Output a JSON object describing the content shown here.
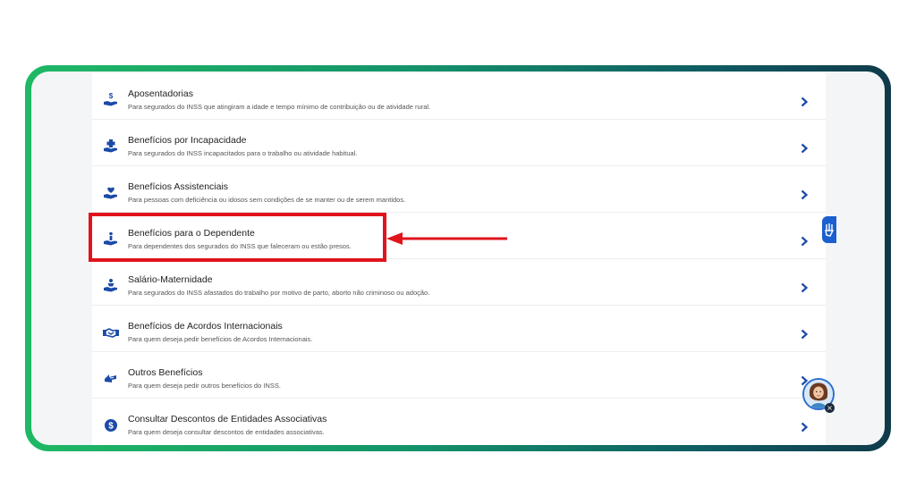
{
  "services": [
    {
      "title": "Aposentadorias",
      "description": "Para segurados do INSS que atingiram a idade e tempo mínimo de contribuição ou de atividade rural.",
      "icon": "hand-dollar-icon"
    },
    {
      "title": "Benefícios por Incapacidade",
      "description": "Para segurados do INSS incapacitados para o trabalho ou atividade habitual.",
      "icon": "hand-medical-cross-icon"
    },
    {
      "title": "Benefícios Assistenciais",
      "description": "Para pessoas com deficiência ou idosos sem condições de se manter ou de serem mantidos.",
      "icon": "hand-heart-icon"
    },
    {
      "title": "Benefícios para o Dependente",
      "description": "Para dependentes dos segurados do INSS que faleceram ou estão presos.",
      "icon": "hand-person-icon"
    },
    {
      "title": "Salário-Maternidade",
      "description": "Para segurados do INSS afastados do trabalho por motivo de parto, aborto não criminoso ou adoção.",
      "icon": "hand-baby-icon"
    },
    {
      "title": "Benefícios de Acordos Internacionais",
      "description": "Para quem deseja pedir benefícios de Acordos Internacionais.",
      "icon": "handshake-icon"
    },
    {
      "title": "Outros Benefícios",
      "description": "Para quem deseja pedir outros benefícios do INSS.",
      "icon": "hand-arrows-icon"
    },
    {
      "title": "Consultar Descontos de Entidades Associativas",
      "description": "Para quem deseja consultar descontos de entidades associativas.",
      "icon": "dollar-circle-icon"
    }
  ],
  "colors": {
    "accent": "#1b4aa8",
    "highlight": "#e0141c",
    "frame_start": "#1fb865",
    "frame_end": "#103a4a"
  },
  "widgets": {
    "accessibility_icon": "accessibility-hands-icon",
    "assistant_icon": "assistant-avatar-icon",
    "close_icon": "close-icon"
  }
}
